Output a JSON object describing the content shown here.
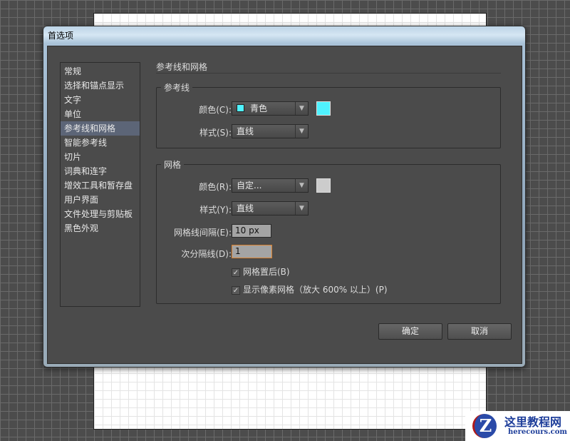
{
  "dialog": {
    "title": "首选项"
  },
  "sidebar": {
    "items": [
      {
        "label": "常规"
      },
      {
        "label": "选择和锚点显示"
      },
      {
        "label": "文字"
      },
      {
        "label": "单位"
      },
      {
        "label": "参考线和网格",
        "selected": true
      },
      {
        "label": "智能参考线"
      },
      {
        "label": "切片"
      },
      {
        "label": "词典和连字"
      },
      {
        "label": "增效工具和暂存盘"
      },
      {
        "label": "用户界面"
      },
      {
        "label": "文件处理与剪贴板"
      },
      {
        "label": "黑色外观"
      }
    ]
  },
  "section": {
    "title": "参考线和网格"
  },
  "guides": {
    "legend": "参考线",
    "color_label": "颜色(C):",
    "color_value": "青色",
    "color_hex": "#4ff2ff",
    "style_label": "样式(S):",
    "style_value": "直线"
  },
  "grid": {
    "legend": "网格",
    "color_label": "颜色(R):",
    "color_value": "自定...",
    "color_hex": "#cccccc",
    "style_label": "样式(Y):",
    "style_value": "直线",
    "spacing_label": "网格线间隔(E):",
    "spacing_value": "10 px",
    "subdiv_label": "次分隔线(D):",
    "subdiv_value": "1",
    "back_label": "网格置后(B)",
    "back_checked": true,
    "pixel_label": "显示像素网格（放大 600% 以上）(P)",
    "pixel_checked": true
  },
  "buttons": {
    "ok": "确定",
    "cancel": "取消"
  },
  "watermark": {
    "name": "这里教程网",
    "url": "herecours.com"
  }
}
